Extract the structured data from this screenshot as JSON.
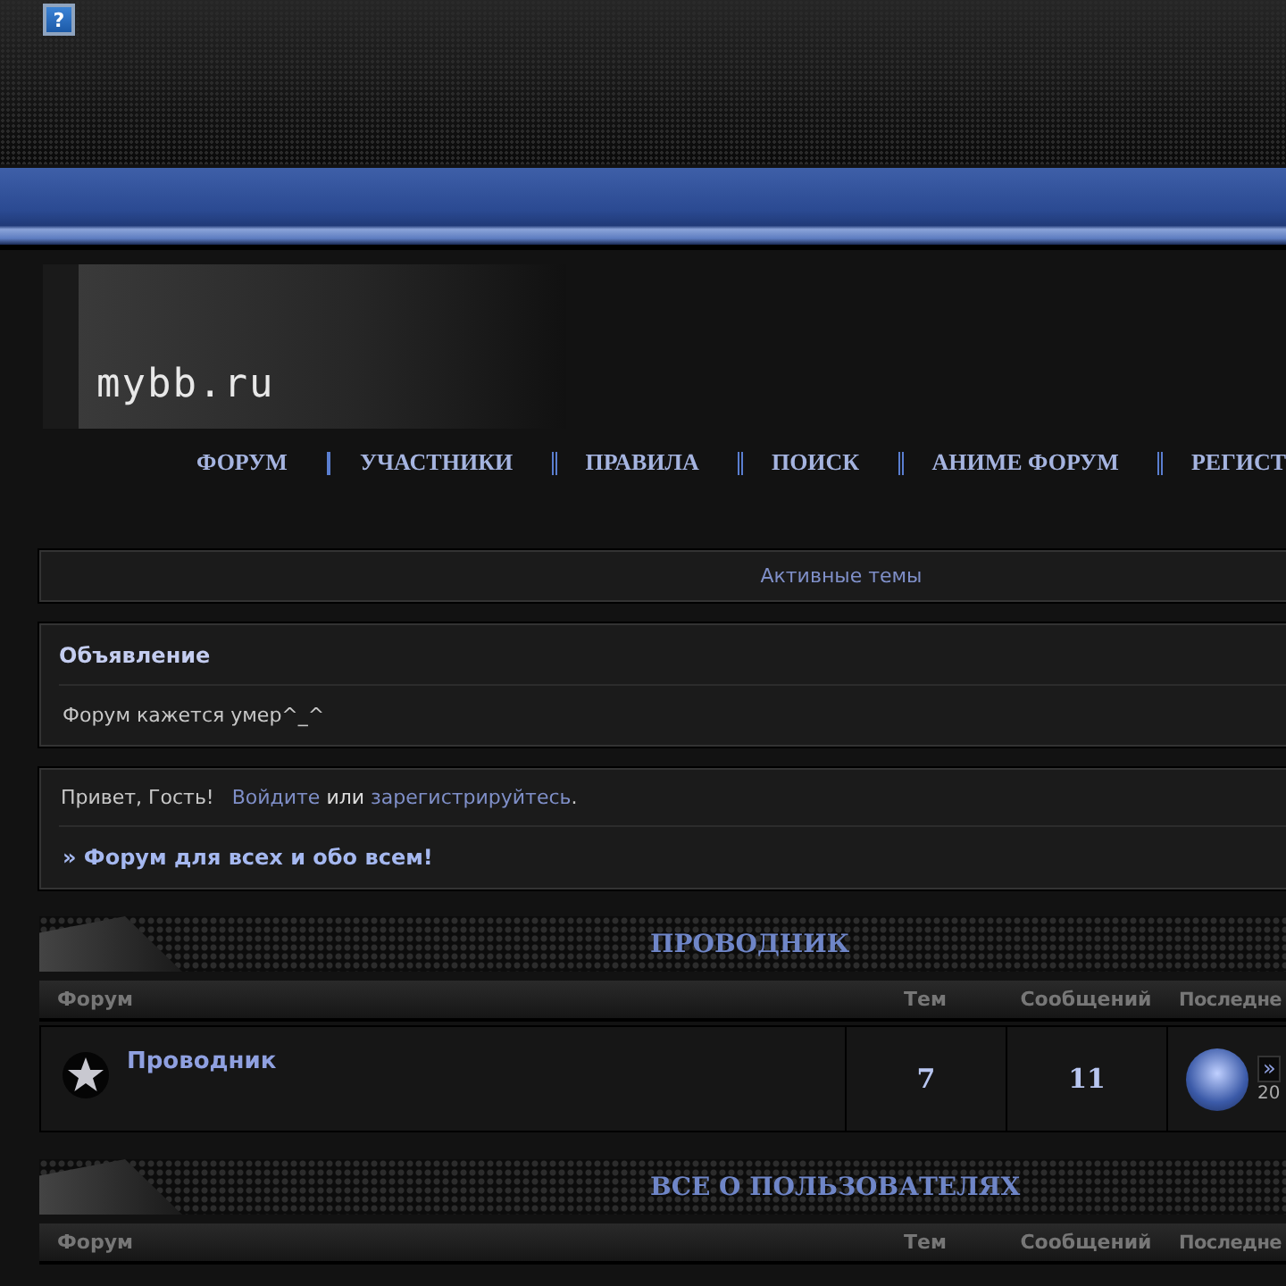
{
  "help_button": {
    "label": "?"
  },
  "logo": {
    "text": "mybb.ru"
  },
  "nav": [
    {
      "label": "ФОРУМ"
    },
    {
      "label": "УЧАСТНИКИ"
    },
    {
      "label": "ПРАВИЛА"
    },
    {
      "label": "ПОИСК"
    },
    {
      "label": "АНИМЕ ФОРУМ"
    },
    {
      "label": "РЕГИСТ"
    }
  ],
  "active_topics": {
    "label": "Активные темы"
  },
  "announcement": {
    "title": "Объявление",
    "text": "Форум кажется умер^_^"
  },
  "welcome": {
    "greeting": "Привет, Гость!",
    "login_link": "Войдите",
    "or": "или",
    "register_link": "зарегистрируйтесь",
    "end": ".",
    "board_title": "» Форум для всех и обо всем!"
  },
  "categories": [
    {
      "title": "ПРОВОДНИК",
      "columns": [
        "Форум",
        "Тем",
        "Сообщений",
        "Последне"
      ],
      "forums": [
        {
          "name": "Проводник",
          "topics": "7",
          "posts": "11",
          "last_post": {
            "link": "»",
            "date": "20"
          }
        }
      ]
    },
    {
      "title": "ВСЕ О ПОЛЬЗОВАТЕЛЯХ",
      "columns": [
        "Форум",
        "Тем",
        "Сообщений",
        "Последне"
      ]
    }
  ]
}
